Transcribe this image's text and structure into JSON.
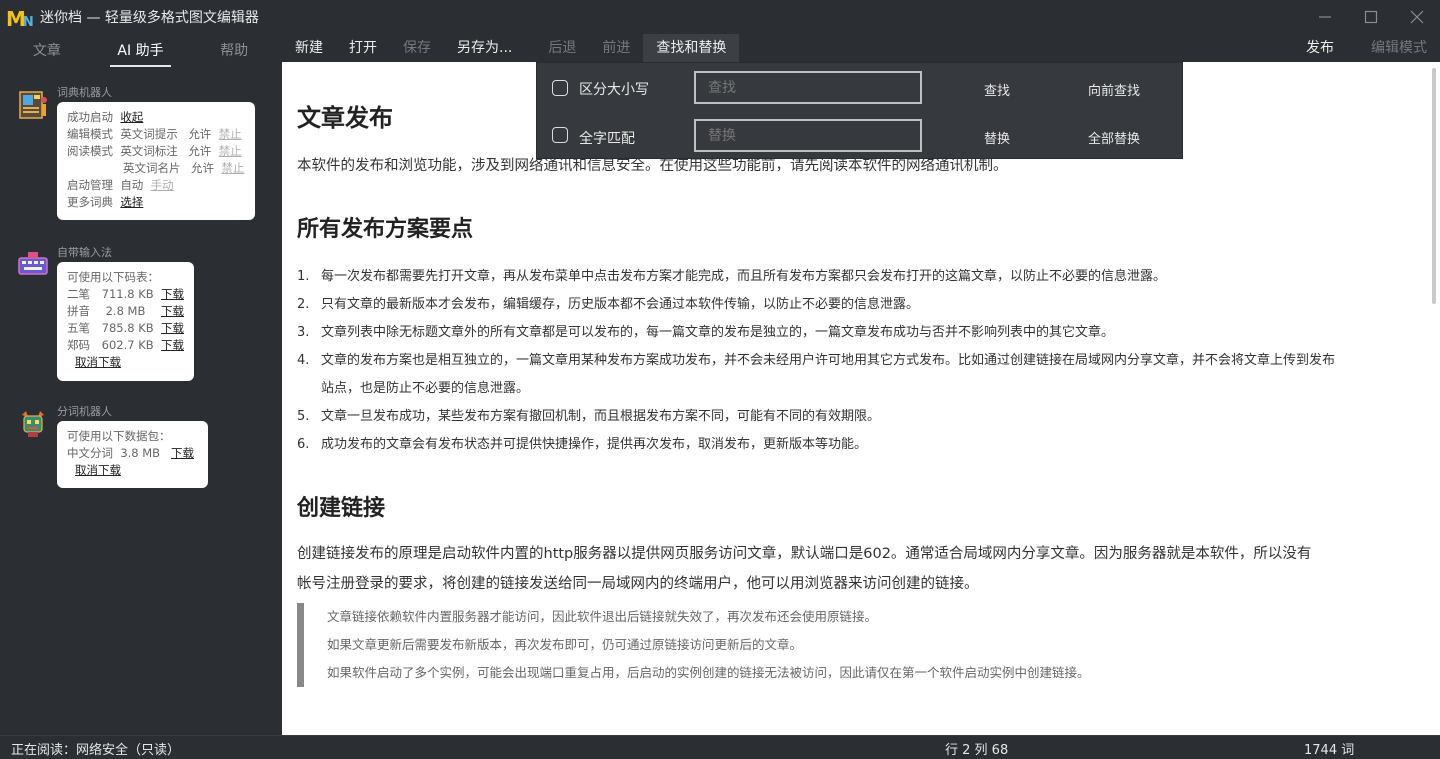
{
  "window": {
    "title": "迷你档 — 轻量级多格式图文编辑器",
    "logo": "MN",
    "controls": [
      "minimize",
      "maximize",
      "close"
    ]
  },
  "sidebar": {
    "tabs": [
      {
        "label": "文章",
        "active": false
      },
      {
        "label": "AI 助手",
        "active": true
      },
      {
        "label": "帮助",
        "active": false
      }
    ],
    "dict_robot": {
      "title": "词典机器人",
      "boot_label": "成功启动",
      "boot_action": "收起",
      "edit_mode_label": "编辑模式",
      "edit_mode_item": "英文词提示",
      "read_mode_label": "阅读模式",
      "read_mode_item1": "英文词标注",
      "read_mode_item2": "英文词名片",
      "allow": "允许",
      "forbid": "禁止",
      "startup_label": "启动管理",
      "startup_value": "自动",
      "startup_manual": "手动",
      "more_label": "更多词典",
      "more_action": "选择"
    },
    "ime": {
      "title": "自带输入法",
      "intro": "可使用以下码表：",
      "items": [
        {
          "name": "二笔",
          "size": "711.8 KB",
          "action": "下载"
        },
        {
          "name": "拼音",
          "size": "2.8 MB",
          "action": "下载"
        },
        {
          "name": "五笔",
          "size": "785.8 KB",
          "action": "下载"
        },
        {
          "name": "郑码",
          "size": "602.7 KB",
          "action": "下载"
        }
      ],
      "cancel": "取消下载"
    },
    "seg": {
      "title": "分词机器人",
      "intro": "可使用以下数据包：",
      "items": [
        {
          "name": "中文分词",
          "size": "3.8 MB",
          "action": "下载"
        }
      ],
      "cancel": "取消下载"
    }
  },
  "toolbar": {
    "new": "新建",
    "open": "打开",
    "save": "保存",
    "save_as": "另存为...",
    "back": "后退",
    "forward": "前进",
    "find_replace": "查找和替换",
    "publish": "发布",
    "edit_mode": "编辑模式"
  },
  "find": {
    "case_label": "区分大小写",
    "whole_label": "全字匹配",
    "find_placeholder": "查找",
    "replace_placeholder": "替换",
    "find_btn": "查找",
    "find_prev_btn": "向前查找",
    "replace_btn": "替换",
    "replace_all_btn": "全部替换"
  },
  "doc": {
    "h1": "文章发布",
    "intro": "本软件的发布和浏览功能，涉及到网络通讯和信息安全。在使用这些功能前，请先阅读本软件的网络通讯机制。",
    "h2_points": "所有发布方案要点",
    "points": [
      {
        "n": "1.",
        "text": "每一次发布都需要先打开文章，再从发布菜单中点击发布方案才能完成，而且所有发布方案都只会发布打开的这篇文章，以防止不必要的信息泄露。"
      },
      {
        "n": "2.",
        "text": "只有文章的最新版本才会发布，编辑缓存，历史版本都不会通过本软件传输，以防止不必要的信息泄露。"
      },
      {
        "n": "3.",
        "text": "文章列表中除无标题文章外的所有文章都是可以发布的，每一篇文章的发布是独立的，一篇文章发布成功与否并不影响列表中的其它文章。"
      },
      {
        "n": "4.",
        "text": "文章的发布方案也是相互独立的，一篇文章用某种发布方案成功发布，并不会未经用户许可地用其它方式发布。比如通过创建链接在局域网内分享文章，并不会将文章上传到发布"
      },
      {
        "n": "",
        "text": "站点，也是防止不必要的信息泄露。"
      },
      {
        "n": "5.",
        "text": "文章一旦发布成功，某些发布方案有撤回机制，而且根据发布方案不同，可能有不同的有效期限。"
      },
      {
        "n": "6.",
        "text": "成功发布的文章会有发布状态并可提供快捷操作，提供再次发布，取消发布，更新版本等功能。"
      }
    ],
    "h2_link": "创建链接",
    "link_p1": "创建链接发布的原理是启动软件内置的http服务器以提供网页服务访问文章，默认端口是602。通常适合局域网内分享文章。因为服务器就是本软件，所以没有",
    "link_p2": "帐号注册登录的要求，将创建的链接发送给同一局域网内的终端用户，他可以用浏览器来访问创建的链接。",
    "quote": [
      "文章链接依赖软件内置服务器才能访问，因此软件退出后链接就失效了，再次发布还会使用原链接。",
      "如果文章更新后需要发布新版本，再次发布即可，仍可通过原链接访问更新后的文章。",
      "如果软件启动了多个实例，可能会出现端口重复占用，后启动的实例创建的链接无法被访问，因此请仅在第一个软件启动实例中创建链接。"
    ]
  },
  "status": {
    "reading": "正在阅读：网络安全（只读）",
    "position": "行 2 列 68",
    "words": "1744 词"
  }
}
